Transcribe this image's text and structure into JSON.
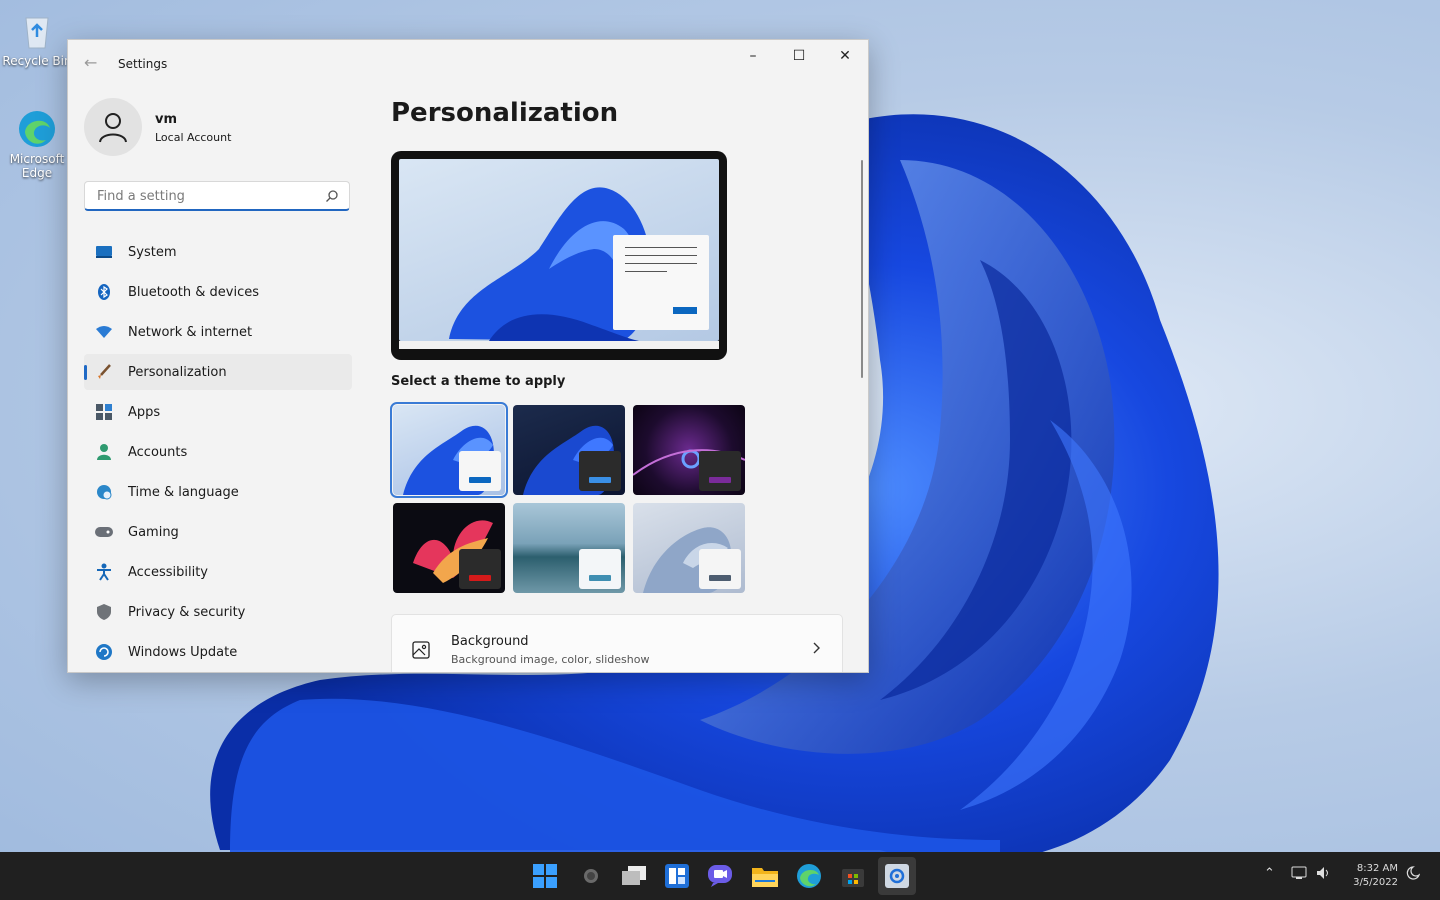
{
  "desktop": {
    "icons": [
      {
        "label": "Recycle Bin",
        "icon": "recycle-bin-icon"
      },
      {
        "label": "Microsoft Edge",
        "icon": "edge-icon"
      }
    ]
  },
  "window": {
    "title": "Settings",
    "controls": {
      "minimize": "–",
      "maximize": "☐",
      "close": "✕"
    }
  },
  "profile": {
    "name": "vm",
    "account_type": "Local Account"
  },
  "search": {
    "placeholder": "Find a setting",
    "value": ""
  },
  "sidebar": {
    "items": [
      {
        "label": "System",
        "icon": "system-icon",
        "color": "#1a6fbf"
      },
      {
        "label": "Bluetooth & devices",
        "icon": "bluetooth-icon",
        "color": "#1565c0"
      },
      {
        "label": "Network & internet",
        "icon": "wifi-icon",
        "color": "#2a7bd4"
      },
      {
        "label": "Personalization",
        "icon": "brush-icon",
        "color": "#d8762a",
        "active": true
      },
      {
        "label": "Apps",
        "icon": "apps-icon",
        "color": "#4a5866"
      },
      {
        "label": "Accounts",
        "icon": "accounts-icon",
        "color": "#2e9a6f"
      },
      {
        "label": "Time & language",
        "icon": "globe-clock-icon",
        "color": "#2b87c9"
      },
      {
        "label": "Gaming",
        "icon": "gamepad-icon",
        "color": "#6a6f77"
      },
      {
        "label": "Accessibility",
        "icon": "accessibility-icon",
        "color": "#1567b8"
      },
      {
        "label": "Privacy & security",
        "icon": "shield-icon",
        "color": "#6f7378"
      },
      {
        "label": "Windows Update",
        "icon": "update-icon",
        "color": "#1f77c6"
      }
    ]
  },
  "main": {
    "heading": "Personalization",
    "theme_section_label": "Select a theme to apply",
    "themes": [
      {
        "name": "windows-light",
        "selected": true
      },
      {
        "name": "windows-dark"
      },
      {
        "name": "glow"
      },
      {
        "name": "captured-motion"
      },
      {
        "name": "sunrise"
      },
      {
        "name": "flow"
      }
    ],
    "background_card": {
      "title": "Background",
      "subtitle": "Background image, color, slideshow"
    }
  },
  "taskbar": {
    "apps": [
      "start-icon",
      "search-icon",
      "task-view-icon",
      "widgets-icon",
      "chat-icon",
      "file-explorer-icon",
      "edge-icon",
      "store-icon",
      "settings-icon"
    ],
    "clock": {
      "time": "8:32 AM",
      "date": "3/5/2022"
    }
  },
  "colors": {
    "accent": "#1f69c5",
    "window_bg": "#f3f3f3",
    "taskbar_bg": "#202020"
  }
}
